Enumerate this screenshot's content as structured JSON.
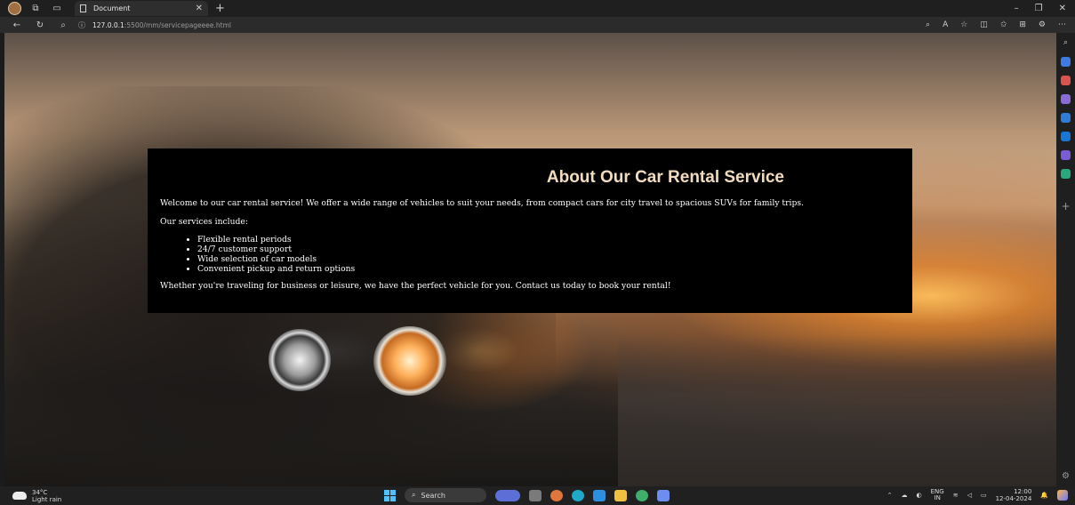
{
  "browser": {
    "tab_title": "Document",
    "url_host": "127.0.0.1",
    "url_rest": ":5500/mm/servicepageeee.html"
  },
  "about": {
    "title": "About Our Car Rental Service",
    "welcome": "Welcome to our car rental service! We offer a wide range of vehicles to suit your needs, from compact cars for city travel to spacious SUVs for family trips.",
    "services_intro": "Our services include:",
    "services": [
      "Flexible rental periods",
      "24/7 customer support",
      "Wide selection of car models",
      "Convenient pickup and return options"
    ],
    "closing": "Whether you're traveling for business or leisure, we have the perfect vehicle for you. Contact us today to book your rental!"
  },
  "taskbar": {
    "weather_temp": "34°C",
    "weather_desc": "Light rain",
    "search_label": "Search",
    "lang": "ENG",
    "lang_region": "IN",
    "time": "12:00",
    "date": "12-04-2024"
  }
}
